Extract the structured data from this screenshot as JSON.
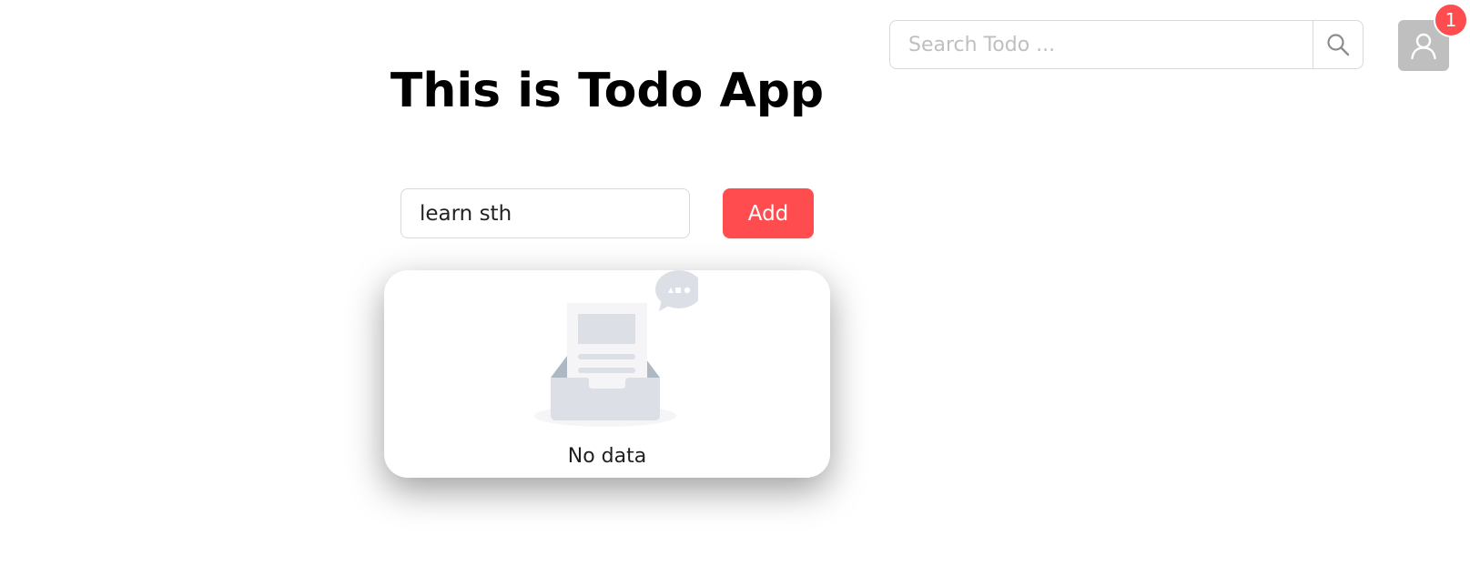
{
  "search": {
    "placeholder": "Search Todo ..."
  },
  "user": {
    "notification_count": "1"
  },
  "header": {
    "title": "This is Todo App"
  },
  "todo_form": {
    "input_value": "learn sth",
    "add_label": "Add"
  },
  "todo_list": {
    "items": [],
    "empty_text": "No data"
  },
  "colors": {
    "accent": "#ff4d4f",
    "avatar_bg": "#bfbfbf",
    "border": "#d9d9d9"
  },
  "icons": {
    "search_button": "search-icon",
    "avatar": "user-icon",
    "empty": "empty-inbox-icon"
  }
}
